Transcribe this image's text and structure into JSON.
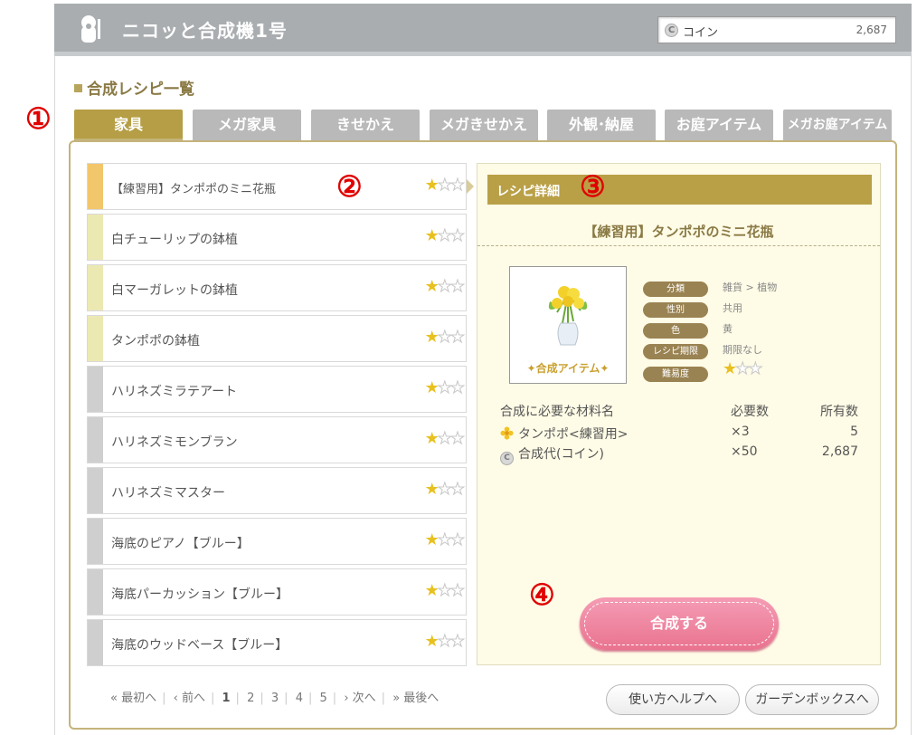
{
  "header": {
    "app_title": "ニコッと合成機1号",
    "coin_label": "コイン",
    "coin_icon_letter": "C",
    "coin_value": "2,687"
  },
  "section_title": "合成レシピ一覧",
  "markers": [
    "①",
    "②",
    "③",
    "④"
  ],
  "tabs": [
    {
      "label": "家具",
      "active": true
    },
    {
      "label": "メガ家具",
      "active": false
    },
    {
      "label": "きせかえ",
      "active": false
    },
    {
      "label": "メガきせかえ",
      "active": false
    },
    {
      "label": "外観･納屋",
      "active": false
    },
    {
      "label": "お庭アイテム",
      "active": false
    },
    {
      "label": "メガお庭アイテム",
      "active": false
    }
  ],
  "recipes": [
    {
      "name": "【練習用】タンポポのミニ花瓶",
      "stars": 1,
      "max_stars": 3
    },
    {
      "name": "白チューリップの鉢植",
      "stars": 1,
      "max_stars": 3
    },
    {
      "name": "白マーガレットの鉢植",
      "stars": 1,
      "max_stars": 3
    },
    {
      "name": "タンポポの鉢植",
      "stars": 1,
      "max_stars": 3
    },
    {
      "name": "ハリネズミラテアート",
      "stars": 1,
      "max_stars": 3
    },
    {
      "name": "ハリネズミモンブラン",
      "stars": 1,
      "max_stars": 3
    },
    {
      "name": "ハリネズミマスター",
      "stars": 1,
      "max_stars": 3
    },
    {
      "name": "海底のピアノ【ブルー】",
      "stars": 1,
      "max_stars": 3
    },
    {
      "name": "海底パーカッション【ブルー】",
      "stars": 1,
      "max_stars": 3
    },
    {
      "name": "海底のウッドベース【ブルー】",
      "stars": 1,
      "max_stars": 3
    }
  ],
  "pager": {
    "first": "« 最初へ",
    "prev": "‹ 前へ",
    "pages": [
      "1",
      "2",
      "3",
      "4",
      "5"
    ],
    "current": "1",
    "next": "› 次へ",
    "last": "» 最後へ"
  },
  "detail": {
    "heading": "レシピ詳細",
    "item_name": "【練習用】タンポポのミニ花瓶",
    "image_caption": "合成アイテム",
    "attributes": [
      {
        "key": "分類",
        "value": "雑貨 > 植物"
      },
      {
        "key": "性別",
        "value": "共用"
      },
      {
        "key": "色",
        "value": "黄"
      },
      {
        "key": "レシピ期限",
        "value": "期限なし"
      },
      {
        "key": "難易度",
        "stars": 1,
        "max_stars": 3
      }
    ],
    "materials_header": {
      "name": "合成に必要な材料名",
      "need": "必要数",
      "have": "所有数"
    },
    "materials": [
      {
        "name": "タンポポ<練習用>",
        "icon": "flower-icon",
        "need": "×3",
        "have": "5"
      },
      {
        "name": "合成代(コイン)",
        "icon": "coin-icon",
        "need": "×50",
        "have": "2,687"
      }
    ]
  },
  "buttons": {
    "craft": "合成する",
    "help": "使い方ヘルプへ",
    "garden_box": "ガーデンボックスへ"
  },
  "colors": {
    "accent": "#b59e45",
    "marker_red": "#e00000",
    "craft_pink": "#ef86a1",
    "star_gold": "#e8c020"
  }
}
